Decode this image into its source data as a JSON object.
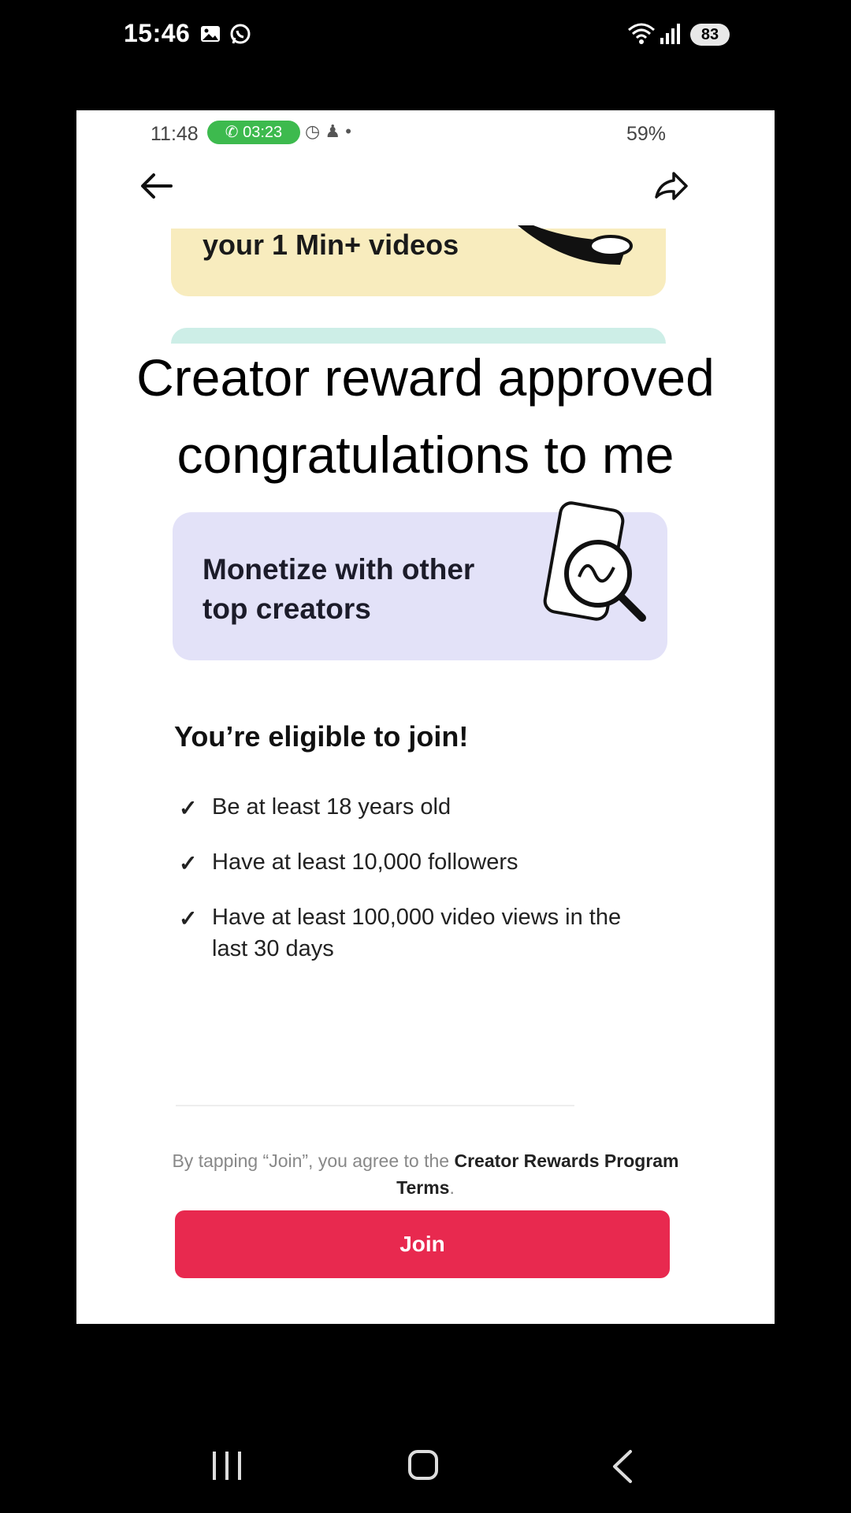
{
  "os_status": {
    "time": "15:46",
    "battery": "83"
  },
  "inner_status": {
    "time": "11:48",
    "call_timer": "03:23",
    "battery": "59%"
  },
  "cards": {
    "top_card_text": "your 1 Min+ videos",
    "monetize_line1": "Monetize with other",
    "monetize_line2": "top creators"
  },
  "caption": {
    "line1": "Creator reward approved",
    "line2": "congratulations to me"
  },
  "eligibility": {
    "title": "You’re eligible to join!",
    "requirements": [
      "Be at least 18 years old",
      "Have at least 10,000 followers",
      "Have at least 100,000 video views in the last 30 days"
    ]
  },
  "terms": {
    "prefix": "By tapping “Join”, you agree to the",
    "link": "Creator Rewards Program Terms",
    "suffix": "."
  },
  "join_label": "Join",
  "colors": {
    "join": "#e8294f",
    "card_purple": "#e3e2f8",
    "card_yellow": "#f8ecbe",
    "call_pill": "#3dba4e"
  }
}
